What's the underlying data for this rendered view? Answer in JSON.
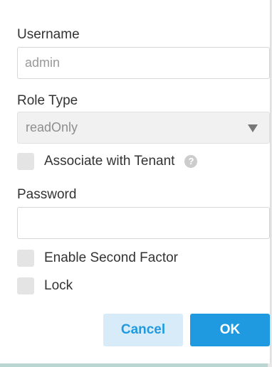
{
  "form": {
    "username_label": "Username",
    "username_value": "admin",
    "role_type_label": "Role Type",
    "role_type_value": "readOnly",
    "associate_tenant_label": "Associate with Tenant",
    "help_symbol": "?",
    "password_label": "Password",
    "password_value": "",
    "second_factor_label": "Enable Second Factor",
    "lock_label": "Lock"
  },
  "buttons": {
    "cancel_label": "Cancel",
    "ok_label": "OK"
  },
  "colors": {
    "primary": "#1f9ae0",
    "secondary_bg": "#d7ecf8"
  },
  "icons": {
    "caret": "chevron-down-icon",
    "help": "help-icon"
  }
}
